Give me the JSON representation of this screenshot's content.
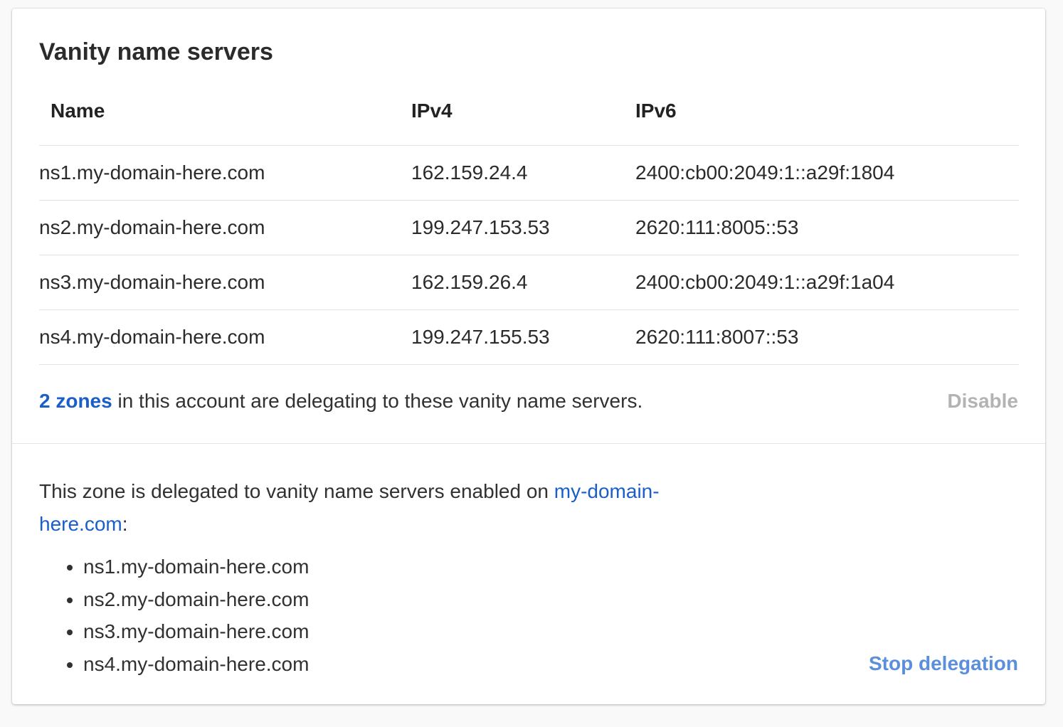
{
  "card": {
    "title": "Vanity name servers"
  },
  "table": {
    "headers": [
      "Name",
      "IPv4",
      "IPv6"
    ],
    "rows": [
      {
        "name": "ns1.my-domain-here.com",
        "ipv4": "162.159.24.4",
        "ipv6": "2400:cb00:2049:1::a29f:1804"
      },
      {
        "name": "ns2.my-domain-here.com",
        "ipv4": "199.247.153.53",
        "ipv6": "2620:111:8005::53"
      },
      {
        "name": "ns3.my-domain-here.com",
        "ipv4": "162.159.26.4",
        "ipv6": "2400:cb00:2049:1::a29f:1a04"
      },
      {
        "name": "ns4.my-domain-here.com",
        "ipv4": "199.247.155.53",
        "ipv6": "2620:111:8007::53"
      }
    ]
  },
  "zones": {
    "link_label": "2 zones",
    "text": " in this account are delegating to these vanity name servers.",
    "disable_label": "Disable"
  },
  "delegation": {
    "text": "This zone is delegated to vanity name servers enabled on ",
    "domain_link": "my-domain-here.com",
    "suffix": ":",
    "servers": [
      "ns1.my-domain-here.com",
      "ns2.my-domain-here.com",
      "ns3.my-domain-here.com",
      "ns4.my-domain-here.com"
    ],
    "stop_label": "Stop delegation"
  },
  "colors": {
    "link": "#1a5fc9",
    "disabled": "#b3b3b3",
    "stop_link": "#5b8fdb"
  }
}
